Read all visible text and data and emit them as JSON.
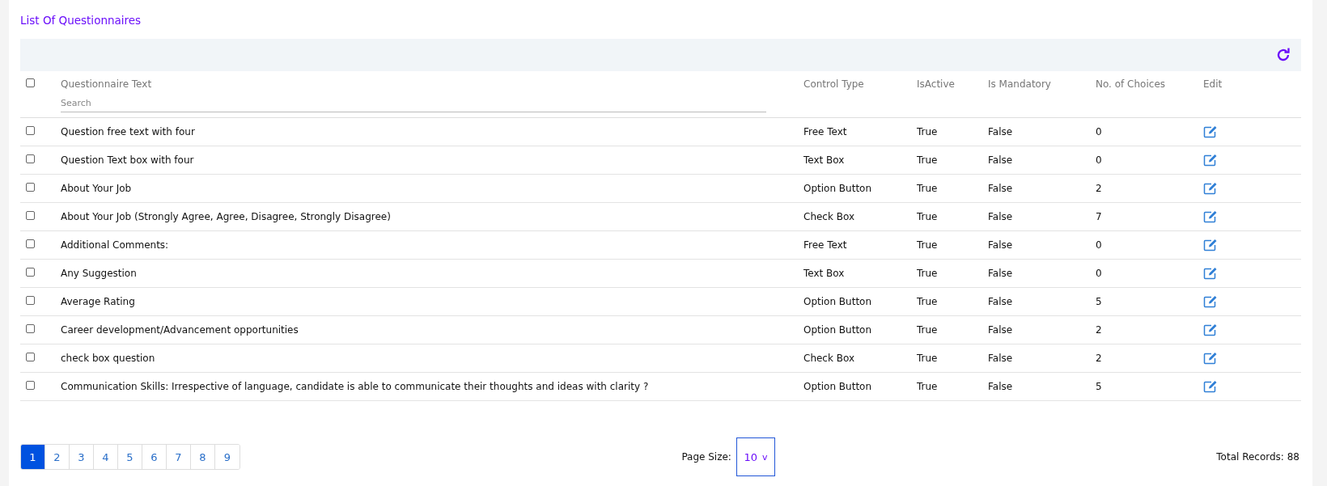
{
  "title": "List Of Questionnaires",
  "table": {
    "columns": [
      "Questionnaire Text",
      "Control Type",
      "IsActive",
      "Is Mandatory",
      "No. of Choices",
      "Edit"
    ],
    "select_all_checked": false,
    "search": {
      "placeholder": "Search"
    },
    "rows": [
      {
        "checked": false,
        "cells": [
          "Question free text with four",
          "Free Text",
          "True",
          "False",
          "0"
        ]
      },
      {
        "checked": false,
        "cells": [
          "Question Text box with four",
          "Text Box",
          "True",
          "False",
          "0"
        ]
      },
      {
        "checked": false,
        "cells": [
          "About Your Job",
          "Option Button",
          "True",
          "False",
          "2"
        ]
      },
      {
        "checked": false,
        "cells": [
          "About Your Job (Strongly Agree, Agree, Disagree, Strongly Disagree)",
          "Check Box",
          "True",
          "False",
          "7"
        ]
      },
      {
        "checked": false,
        "cells": [
          "Additional Comments:",
          "Free Text",
          "True",
          "False",
          "0"
        ]
      },
      {
        "checked": false,
        "cells": [
          "Any Suggestion",
          "Text Box",
          "True",
          "False",
          "0"
        ]
      },
      {
        "checked": false,
        "cells": [
          "Average Rating",
          "Option Button",
          "True",
          "False",
          "5"
        ]
      },
      {
        "checked": false,
        "cells": [
          "Career development/Advancement opportunities",
          "Option Button",
          "True",
          "False",
          "2"
        ]
      },
      {
        "checked": false,
        "cells": [
          "check box question",
          "Check Box",
          "True",
          "False",
          "2"
        ]
      },
      {
        "checked": false,
        "cells": [
          "Communication Skills: Irrespective of language, candidate is able to communicate their thoughts and ideas with clarity ?",
          "Option Button",
          "True",
          "False",
          "5"
        ]
      }
    ]
  },
  "pagination": {
    "pages": [
      {
        "label": "1",
        "selected": true
      },
      {
        "label": "2",
        "selected": false
      },
      {
        "label": "3",
        "selected": false
      },
      {
        "label": "4",
        "selected": false
      },
      {
        "label": "5",
        "selected": false
      },
      {
        "label": "6",
        "selected": false
      },
      {
        "label": "7",
        "selected": false
      },
      {
        "label": "8",
        "selected": false
      },
      {
        "label": "9",
        "selected": false
      }
    ],
    "page_size_label": "Page Size:",
    "page_size": "10",
    "page_size_caret": "v",
    "total": "Total Records: 88"
  }
}
